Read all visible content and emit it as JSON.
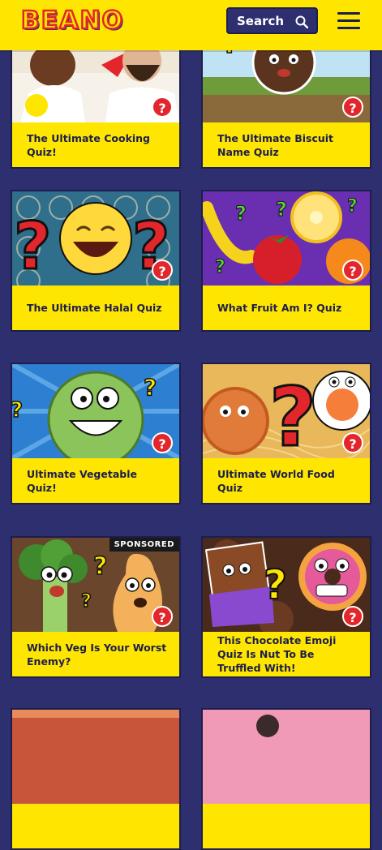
{
  "header": {
    "logo": "BEANO",
    "search_label": "Search"
  },
  "cards": [
    {
      "title": "The Ultimate Cooking Quiz!"
    },
    {
      "title": "The Ultimate Biscuit Name Quiz"
    },
    {
      "title": "The Ultimate Halal Quiz"
    },
    {
      "title": "What Fruit Am I? Quiz"
    },
    {
      "title": "Ultimate Vegetable Quiz!"
    },
    {
      "title": "Ultimate World Food Quiz"
    },
    {
      "title": "Which Veg Is Your Worst Enemy?",
      "badge": "SPONSORED"
    },
    {
      "title": "This Chocolate Emoji Quiz Is Nut To Be Truffled With!"
    }
  ],
  "quiz_badge_symbol": "?",
  "colors": {
    "background": "#2e2f6e",
    "brand_yellow": "#ffe600",
    "brand_red": "#e3262c",
    "navy": "#1d1e4d"
  }
}
